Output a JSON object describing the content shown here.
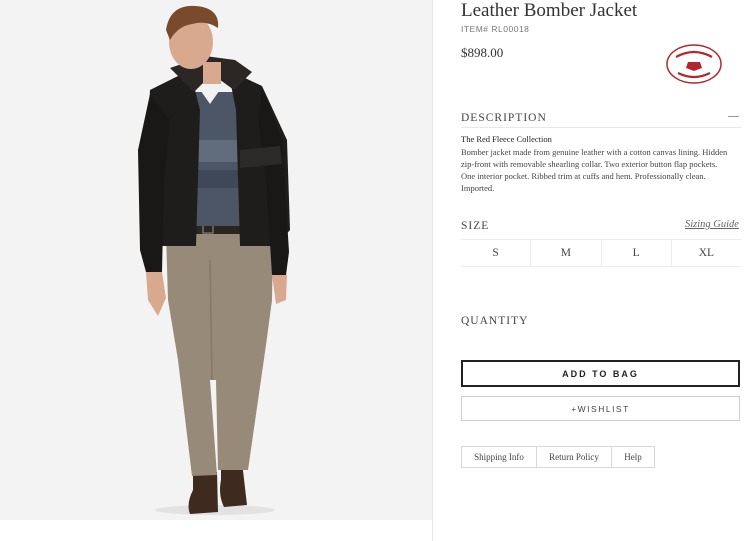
{
  "product": {
    "title": "Leather Bomber Jacket",
    "item_code": "ITEM# RL00018",
    "price": "$898.00",
    "brand_logo": "brooks-brothers-red-fleece-logo"
  },
  "description": {
    "heading": "DESCRIPTION",
    "subtitle": "The Red Fleece Collection",
    "lines": [
      "Bomber jacket made from genuine leather with a cotton canvas lining. Hidden",
      "zip-front with removable shearling collar. Two exterior button flap pockets.",
      "One interior pocket. Ribbed trim at cuffs and hem. Professionally clean.",
      "Imported."
    ]
  },
  "size": {
    "heading": "SIZE",
    "guide_label": "Sizing Guide",
    "options": [
      "S",
      "M",
      "L",
      "XL"
    ]
  },
  "quantity": {
    "heading": "QUANTITY"
  },
  "actions": {
    "add_to_bag": "ADD TO BAG",
    "wishlist": "+WISHLIST"
  },
  "tabs": [
    "Shipping Info",
    "Return Policy",
    "Help"
  ],
  "colors": {
    "accent": "#222222",
    "logo_red": "#b3262e"
  }
}
